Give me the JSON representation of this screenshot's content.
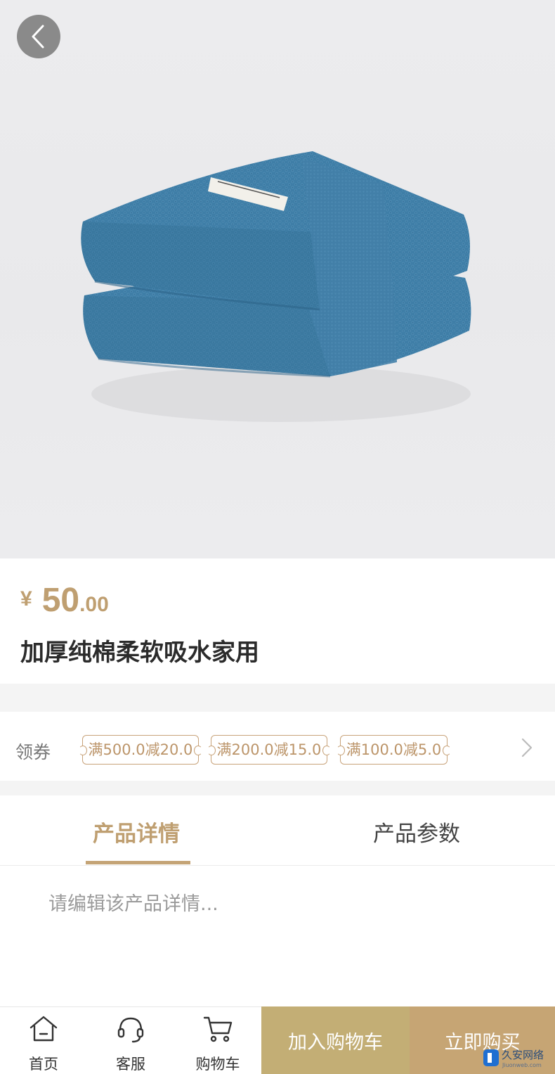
{
  "product": {
    "currency": "¥",
    "price_int": "50",
    "price_dec": ".00",
    "title": "加厚纯棉柔软吸水家用",
    "image": "blue-folded-towel-photo"
  },
  "coupons": {
    "label": "领券",
    "items": [
      "满500.0减20.0",
      "满200.0减15.0",
      "满100.0减5.0"
    ]
  },
  "tabs": {
    "active": "产品详情",
    "inactive": "产品参数"
  },
  "detail": {
    "placeholder": "请编辑该产品详情..."
  },
  "bottom_nav": {
    "home": "首页",
    "service": "客服",
    "cart": "购物车",
    "add_to_cart": "加入购物车",
    "buy_now": "立即购买"
  },
  "watermark": {
    "name": "久安网络",
    "sub": "Jiuonweb.com"
  },
  "colors": {
    "accent": "#bf9f71",
    "cart_button": "#c3ae75",
    "buy_button": "#c6a574"
  }
}
